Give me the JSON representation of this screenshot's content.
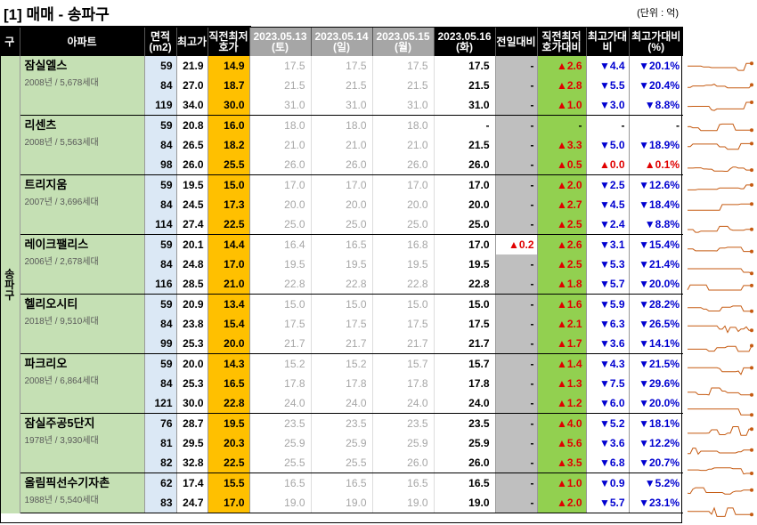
{
  "title": "[1] 매매 - 송파구",
  "unit": "(단위 : 억)",
  "headers": {
    "gu": "구",
    "apt": "아파트",
    "area": [
      "면적",
      "(m2)"
    ],
    "hi": "최고가",
    "low": [
      "직전최저",
      "호가"
    ],
    "dates": [
      [
        "2023.05.13",
        "(토)"
      ],
      [
        "2023.05.14",
        "(일)"
      ],
      [
        "2023.05.15",
        "(월)"
      ],
      [
        "2023.05.16",
        "(화)"
      ]
    ],
    "chg": "전일대비",
    "vs": [
      "직전최저",
      "호가대비"
    ],
    "maxd": [
      "최고가대",
      "비"
    ],
    "maxp": [
      "최고가대비",
      "(%)"
    ]
  },
  "gu_name": [
    "송",
    "파",
    "구"
  ],
  "apartments": [
    {
      "name": "잠실엘스",
      "sub": "2008년 / 5,678세대",
      "rows": [
        {
          "area": "59",
          "hi": "21.9",
          "low": "14.9",
          "p": [
            "17.5",
            "17.5",
            "17.5"
          ],
          "cur": "17.5",
          "chg": "-",
          "vs": "▲2.6",
          "vsc": "up",
          "md": "▼4.4",
          "mdc": "dn",
          "mp": "▼20.1%",
          "mpc": "dn"
        },
        {
          "area": "84",
          "hi": "27.0",
          "low": "18.7",
          "p": [
            "21.5",
            "21.5",
            "21.5"
          ],
          "cur": "21.5",
          "chg": "-",
          "vs": "▲2.8",
          "vsc": "up",
          "md": "▼5.5",
          "mdc": "dn",
          "mp": "▼20.4%",
          "mpc": "dn"
        },
        {
          "area": "119",
          "hi": "34.0",
          "low": "30.0",
          "p": [
            "31.0",
            "31.0",
            "31.0"
          ],
          "cur": "31.0",
          "chg": "-",
          "vs": "▲1.0",
          "vsc": "up",
          "md": "▼3.0",
          "mdc": "dn",
          "mp": "▼8.8%",
          "mpc": "dn"
        }
      ]
    },
    {
      "name": "리센츠",
      "sub": "2008년 / 5,563세대",
      "rows": [
        {
          "area": "59",
          "hi": "20.8",
          "low": "16.0",
          "p": [
            "18.0",
            "18.0",
            "18.0"
          ],
          "cur": "-",
          "chg": "-",
          "vs": "-",
          "vsc": "nt",
          "md": "-",
          "mdc": "nt",
          "mp": "-",
          "mpc": "nt"
        },
        {
          "area": "84",
          "hi": "26.5",
          "low": "18.2",
          "p": [
            "21.0",
            "21.0",
            "21.0"
          ],
          "cur": "21.5",
          "chg": "-",
          "vs": "▲3.3",
          "vsc": "up",
          "md": "▼5.0",
          "mdc": "dn",
          "mp": "▼18.9%",
          "mpc": "dn"
        },
        {
          "area": "98",
          "hi": "26.0",
          "low": "25.5",
          "p": [
            "26.0",
            "26.0",
            "26.0"
          ],
          "cur": "26.0",
          "chg": "-",
          "vs": "▲0.5",
          "vsc": "up",
          "md": "▲0.0",
          "mdc": "up",
          "mp": "▲0.1%",
          "mpc": "up"
        }
      ]
    },
    {
      "name": "트리지움",
      "sub": "2007년 / 3,696세대",
      "rows": [
        {
          "area": "59",
          "hi": "19.5",
          "low": "15.0",
          "p": [
            "17.0",
            "17.0",
            "17.0"
          ],
          "cur": "17.0",
          "chg": "-",
          "vs": "▲2.0",
          "vsc": "up",
          "md": "▼2.5",
          "mdc": "dn",
          "mp": "▼12.6%",
          "mpc": "dn"
        },
        {
          "area": "84",
          "hi": "24.5",
          "low": "17.3",
          "p": [
            "20.0",
            "20.0",
            "20.0"
          ],
          "cur": "20.0",
          "chg": "-",
          "vs": "▲2.7",
          "vsc": "up",
          "md": "▼4.5",
          "mdc": "dn",
          "mp": "▼18.4%",
          "mpc": "dn"
        },
        {
          "area": "114",
          "hi": "27.4",
          "low": "22.5",
          "p": [
            "25.0",
            "25.0",
            "25.0"
          ],
          "cur": "25.0",
          "chg": "-",
          "vs": "▲2.5",
          "vsc": "up",
          "md": "▼2.4",
          "mdc": "dn",
          "mp": "▼8.8%",
          "mpc": "dn"
        }
      ]
    },
    {
      "name": "레이크팰리스",
      "sub": "2006년 / 2,678세대",
      "rows": [
        {
          "area": "59",
          "hi": "20.1",
          "low": "14.4",
          "p": [
            "16.4",
            "16.5",
            "16.8"
          ],
          "cur": "17.0",
          "chg": "▲0.2",
          "vs": "▲2.6",
          "vsc": "up",
          "md": "▼3.1",
          "mdc": "dn",
          "mp": "▼15.4%",
          "mpc": "dn"
        },
        {
          "area": "84",
          "hi": "24.8",
          "low": "17.0",
          "p": [
            "19.5",
            "19.5",
            "19.5"
          ],
          "cur": "19.5",
          "chg": "-",
          "vs": "▲2.5",
          "vsc": "up",
          "md": "▼5.3",
          "mdc": "dn",
          "mp": "▼21.4%",
          "mpc": "dn"
        },
        {
          "area": "116",
          "hi": "28.5",
          "low": "21.0",
          "p": [
            "22.8",
            "22.8",
            "22.8"
          ],
          "cur": "22.8",
          "chg": "-",
          "vs": "▲1.8",
          "vsc": "up",
          "md": "▼5.7",
          "mdc": "dn",
          "mp": "▼20.0%",
          "mpc": "dn"
        }
      ]
    },
    {
      "name": "헬리오시티",
      "sub": "2018년 / 9,510세대",
      "rows": [
        {
          "area": "59",
          "hi": "20.9",
          "low": "13.4",
          "p": [
            "15.0",
            "15.0",
            "15.0"
          ],
          "cur": "15.0",
          "chg": "-",
          "vs": "▲1.6",
          "vsc": "up",
          "md": "▼5.9",
          "mdc": "dn",
          "mp": "▼28.2%",
          "mpc": "dn"
        },
        {
          "area": "84",
          "hi": "23.8",
          "low": "15.4",
          "p": [
            "17.5",
            "17.5",
            "17.5"
          ],
          "cur": "17.5",
          "chg": "-",
          "vs": "▲2.1",
          "vsc": "up",
          "md": "▼6.3",
          "mdc": "dn",
          "mp": "▼26.5%",
          "mpc": "dn"
        },
        {
          "area": "99",
          "hi": "25.3",
          "low": "20.0",
          "p": [
            "21.7",
            "21.7",
            "21.7"
          ],
          "cur": "21.7",
          "chg": "-",
          "vs": "▲1.7",
          "vsc": "up",
          "md": "▼3.6",
          "mdc": "dn",
          "mp": "▼14.1%",
          "mpc": "dn"
        }
      ]
    },
    {
      "name": "파크리오",
      "sub": "2008년 / 6,864세대",
      "rows": [
        {
          "area": "59",
          "hi": "20.0",
          "low": "14.3",
          "p": [
            "15.2",
            "15.2",
            "15.7"
          ],
          "cur": "15.7",
          "chg": "-",
          "vs": "▲1.4",
          "vsc": "up",
          "md": "▼4.3",
          "mdc": "dn",
          "mp": "▼21.5%",
          "mpc": "dn"
        },
        {
          "area": "84",
          "hi": "25.3",
          "low": "16.5",
          "p": [
            "17.8",
            "17.8",
            "17.8"
          ],
          "cur": "17.8",
          "chg": "-",
          "vs": "▲1.3",
          "vsc": "up",
          "md": "▼7.5",
          "mdc": "dn",
          "mp": "▼29.6%",
          "mpc": "dn"
        },
        {
          "area": "121",
          "hi": "30.0",
          "low": "22.8",
          "p": [
            "24.0",
            "24.0",
            "24.0"
          ],
          "cur": "24.0",
          "chg": "-",
          "vs": "▲1.2",
          "vsc": "up",
          "md": "▼6.0",
          "mdc": "dn",
          "mp": "▼20.0%",
          "mpc": "dn"
        }
      ]
    },
    {
      "name": "잠실주공5단지",
      "sub": "1978년 / 3,930세대",
      "rows": [
        {
          "area": "76",
          "hi": "28.7",
          "low": "19.5",
          "p": [
            "23.5",
            "23.5",
            "23.5"
          ],
          "cur": "23.5",
          "chg": "-",
          "vs": "▲4.0",
          "vsc": "up",
          "md": "▼5.2",
          "mdc": "dn",
          "mp": "▼18.1%",
          "mpc": "dn"
        },
        {
          "area": "81",
          "hi": "29.5",
          "low": "20.3",
          "p": [
            "25.9",
            "25.9",
            "25.9"
          ],
          "cur": "25.9",
          "chg": "-",
          "vs": "▲5.6",
          "vsc": "up",
          "md": "▼3.6",
          "mdc": "dn",
          "mp": "▼12.2%",
          "mpc": "dn"
        },
        {
          "area": "82",
          "hi": "32.8",
          "low": "22.5",
          "p": [
            "25.5",
            "25.5",
            "26.0"
          ],
          "cur": "26.0",
          "chg": "-",
          "vs": "▲3.5",
          "vsc": "up",
          "md": "▼6.8",
          "mdc": "dn",
          "mp": "▼20.7%",
          "mpc": "dn"
        }
      ]
    },
    {
      "name": "올림픽선수기자촌",
      "sub": "1988년 / 5,540세대",
      "rows": [
        {
          "area": "62",
          "hi": "17.4",
          "low": "15.5",
          "p": [
            "16.5",
            "16.5",
            "16.5"
          ],
          "cur": "16.5",
          "chg": "-",
          "vs": "▲1.0",
          "vsc": "up",
          "md": "▼0.9",
          "mdc": "dn",
          "mp": "▼5.2%",
          "mpc": "dn"
        },
        {
          "area": "83",
          "hi": "24.7",
          "low": "17.0",
          "p": [
            "19.0",
            "19.0",
            "19.0"
          ],
          "cur": "19.0",
          "chg": "-",
          "vs": "▲2.0",
          "vsc": "up",
          "md": "▼5.7",
          "mdc": "dn",
          "mp": "▼23.1%",
          "mpc": "dn"
        }
      ]
    }
  ],
  "colors": {
    "up": "#e00000",
    "down": "#0000d0",
    "spark": "#c55a11",
    "low_fill": "#ffc000",
    "vs_fill": "#92d050",
    "apt_fill": "#c5e0b4",
    "area_fill": "#dbe8f5"
  }
}
